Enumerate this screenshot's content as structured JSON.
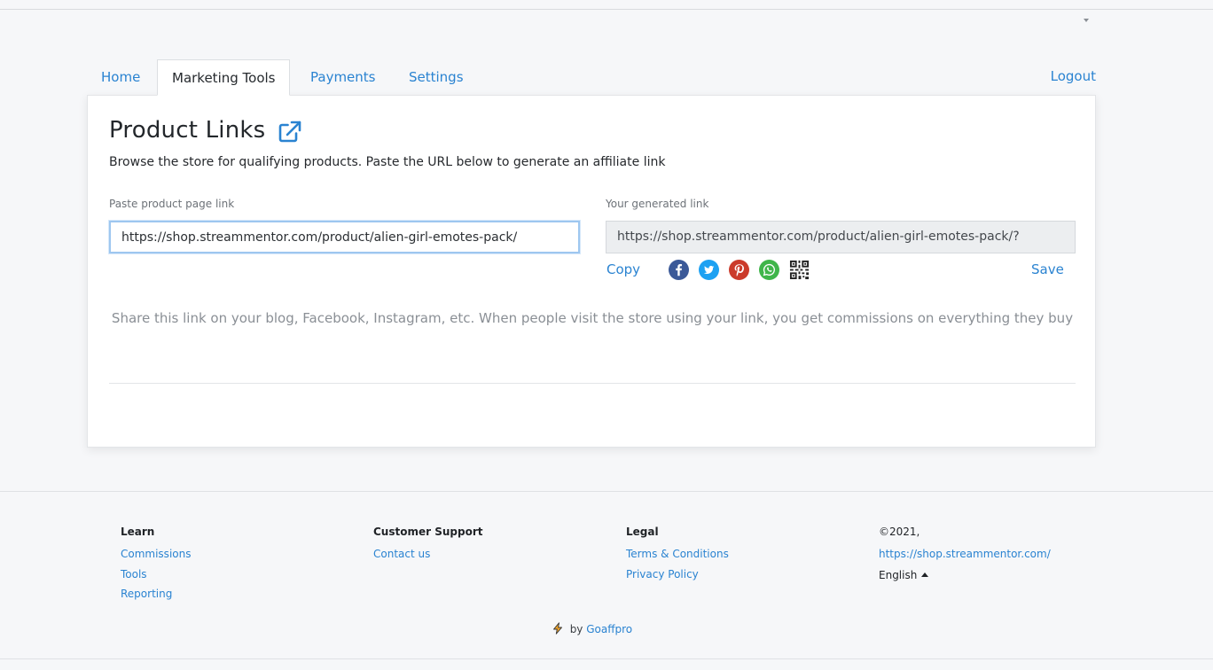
{
  "tabs": {
    "home": "Home",
    "marketing_tools": "Marketing Tools",
    "payments": "Payments",
    "settings": "Settings",
    "logout": "Logout"
  },
  "card": {
    "title": "Product Links",
    "title_icon": "external-link-icon",
    "subtitle": "Browse the store for qualifying products. Paste the URL below to generate an affiliate link",
    "paste_label": "Paste product page link",
    "paste_value": "https://shop.streammentor.com/product/alien-girl-emotes-pack/",
    "generated_label": "Your generated link",
    "generated_value": "https://shop.streammentor.com/product/alien-girl-emotes-pack/?",
    "copy_label": "Copy",
    "save_label": "Save",
    "share_icons": [
      "facebook-icon",
      "twitter-icon",
      "pinterest-icon",
      "whatsapp-icon",
      "qr-code-icon"
    ],
    "share_text": "Share this link on your blog, Facebook, Instagram, etc. When people visit the store using your link, you get commissions on everything they buy"
  },
  "footer": {
    "learn": {
      "heading": "Learn",
      "links": [
        "Commissions",
        "Tools",
        "Reporting"
      ]
    },
    "support": {
      "heading": "Customer Support",
      "links": [
        "Contact us"
      ]
    },
    "legal": {
      "heading": "Legal",
      "links": [
        "Terms & Conditions",
        "Privacy Policy"
      ]
    },
    "copyright": "©2021,",
    "store_url": "https://shop.streammentor.com/",
    "language": "English",
    "powered_by": "by",
    "powered_brand": "Goaffpro"
  },
  "colors": {
    "accent": "#2a83d1",
    "facebook": "#3b5998",
    "twitter": "#1da1f2",
    "pinterest": "#cb2027",
    "whatsapp": "#25d366"
  }
}
